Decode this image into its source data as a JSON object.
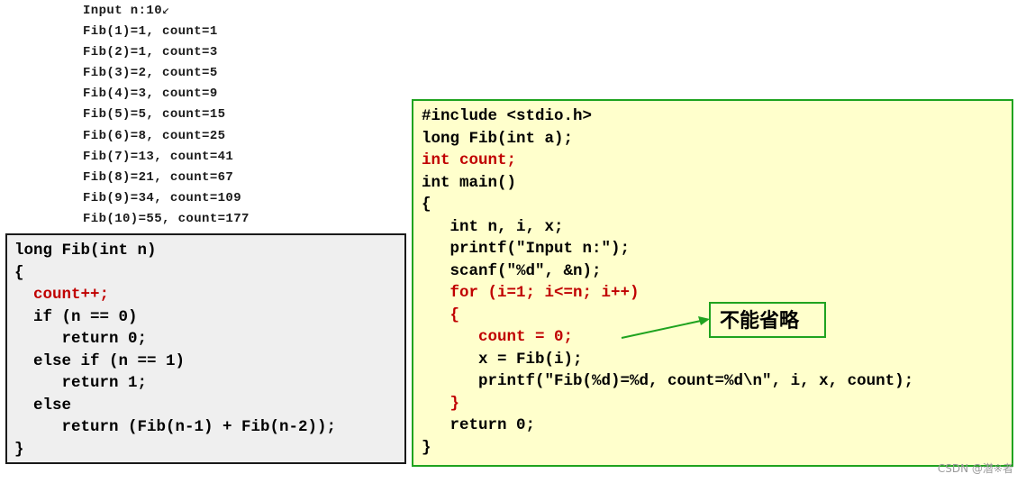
{
  "output_lines": [
    "Input n:10",
    "Fib(1)=1, count=1",
    "Fib(2)=1, count=3",
    "Fib(3)=2, count=5",
    "Fib(4)=3, count=9",
    "Fib(5)=5, count=15",
    "Fib(6)=8, count=25",
    "Fib(7)=13, count=41",
    "Fib(8)=21, count=67",
    "Fib(9)=34, count=109",
    "Fib(10)=55, count=177"
  ],
  "enter_mark": "↙",
  "fib_code": [
    {
      "text": "long Fib(int n)",
      "color": "black"
    },
    {
      "text": "{",
      "color": "black"
    },
    {
      "text": "  count++;",
      "color": "red"
    },
    {
      "text": "  if (n == 0)",
      "color": "black"
    },
    {
      "text": "     return 0;",
      "color": "black"
    },
    {
      "text": "  else if (n == 1)",
      "color": "black"
    },
    {
      "text": "     return 1;",
      "color": "black"
    },
    {
      "text": "  else",
      "color": "black"
    },
    {
      "text": "     return (Fib(n-1) + Fib(n-2));",
      "color": "black"
    },
    {
      "text": "}",
      "color": "black"
    }
  ],
  "main_code": [
    {
      "text": "#include <stdio.h>",
      "color": "black"
    },
    {
      "text": "long Fib(int a);",
      "color": "black"
    },
    {
      "text": "int count;",
      "color": "red"
    },
    {
      "text": "int main()",
      "color": "black"
    },
    {
      "text": "{",
      "color": "black"
    },
    {
      "text": "   int n, i, x;",
      "color": "black"
    },
    {
      "text": "   printf(\"Input n:\");",
      "color": "black"
    },
    {
      "text": "   scanf(\"%d\", &n);",
      "color": "black"
    },
    {
      "text": "   for (i=1; i<=n; i++)",
      "color": "red"
    },
    {
      "text": "   {",
      "color": "red"
    },
    {
      "text": "      count = 0;",
      "color": "red"
    },
    {
      "text": "      x = Fib(i);",
      "color": "black"
    },
    {
      "text": "      printf(\"Fib(%d)=%d, count=%d\\n\", i, x, count);",
      "color": "black"
    },
    {
      "text": "   }",
      "color": "red"
    },
    {
      "text": "   return 0;",
      "color": "black"
    },
    {
      "text": "}",
      "color": "black"
    }
  ],
  "callout_text": "不能省略",
  "watermark": "CSDN @潜※者",
  "colors": {
    "code_red": "#c00000",
    "green_border": "#1fa31f",
    "right_box_bg": "#ffffcc",
    "left_box_bg": "#efefef"
  }
}
